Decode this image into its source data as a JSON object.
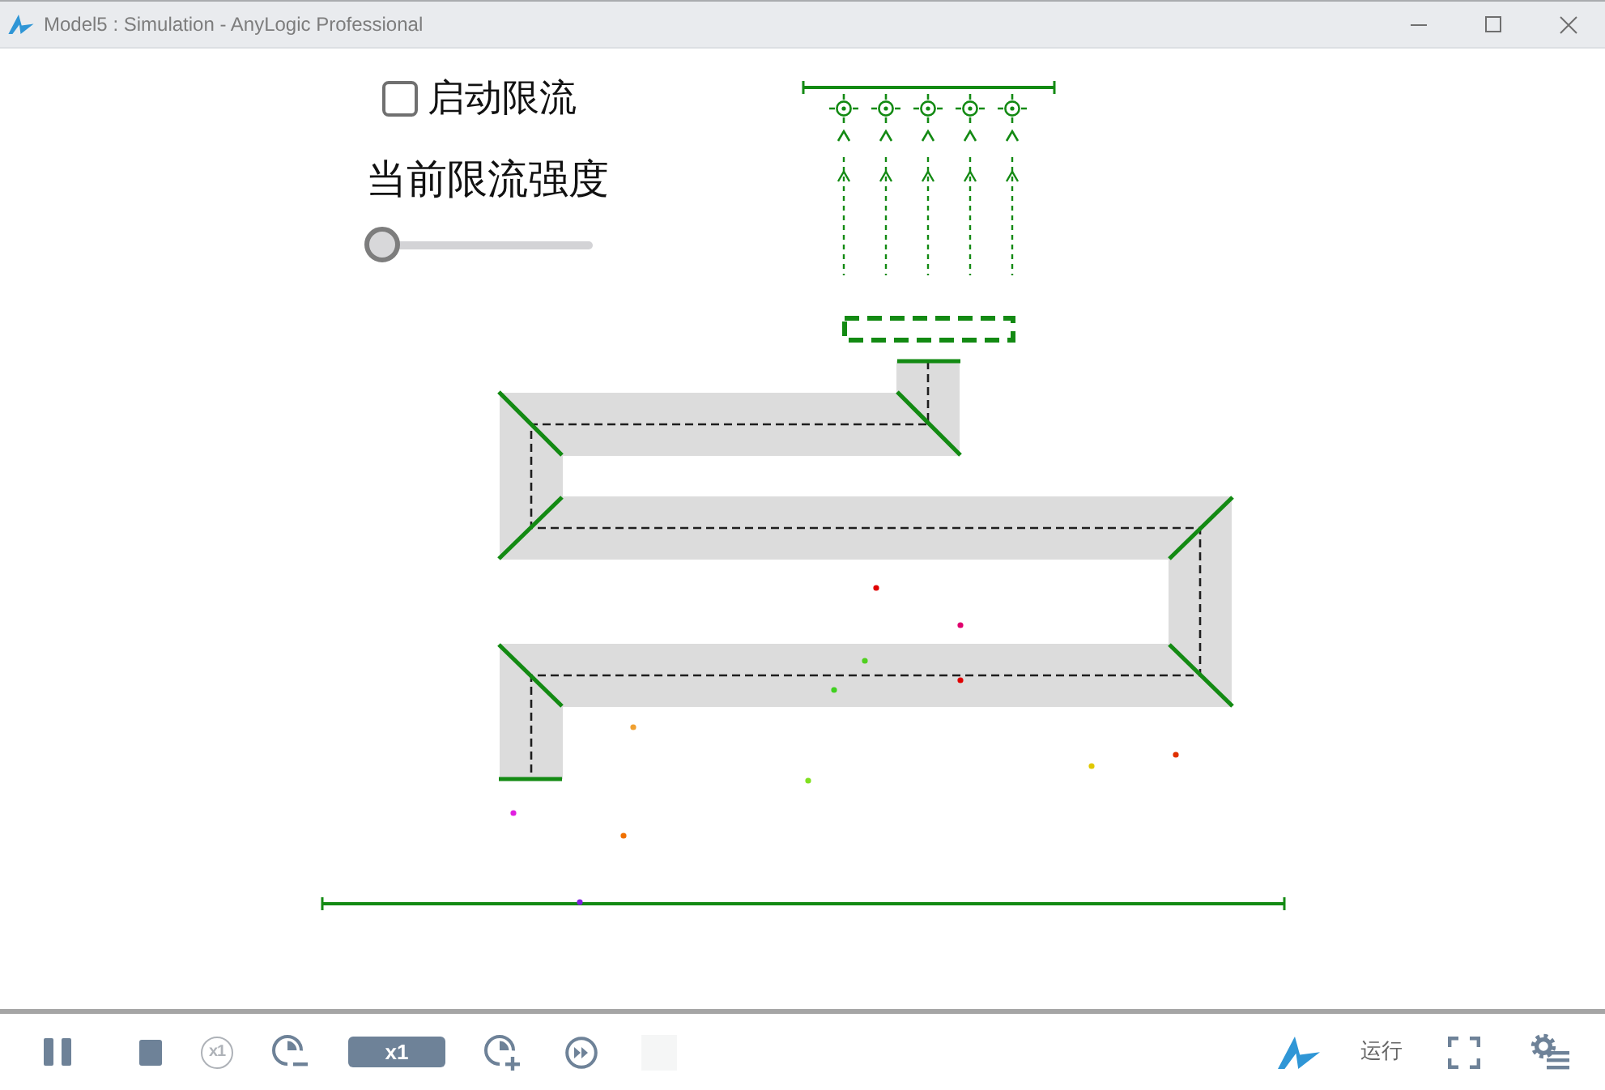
{
  "window": {
    "title": "Model5 : Simulation - AnyLogic Professional",
    "controls": [
      {
        "kind": "minimize"
      },
      {
        "kind": "maximize"
      },
      {
        "kind": "close"
      }
    ]
  },
  "canvas": {
    "checkbox": {
      "label": "启动限流",
      "checked": false
    },
    "slider": {
      "label": "当前限流强度",
      "level": 0
    },
    "agents": [
      {
        "color": "#e00000"
      },
      {
        "color": "#e0006e"
      },
      {
        "color": "#50d020"
      },
      {
        "color": "#e00000"
      },
      {
        "color": "#40d020"
      },
      {
        "color": "#f0a030"
      },
      {
        "color": "#e03000"
      },
      {
        "color": "#e0c800"
      },
      {
        "color": "#80e020"
      },
      {
        "color": "#e020e0"
      },
      {
        "color": "#f07000"
      },
      {
        "color": "#8020e0"
      }
    ]
  },
  "toolbar": {
    "left": [
      {
        "kind": "pause",
        "disabled": false
      },
      {
        "kind": "stop",
        "disabled": false
      },
      {
        "kind": "reset_speed",
        "label": "x1",
        "disabled": true
      },
      {
        "kind": "slow_down",
        "disabled": false
      },
      {
        "kind": "speed",
        "label": "x1",
        "disabled": false
      },
      {
        "kind": "speed_up",
        "disabled": false
      },
      {
        "kind": "run_max",
        "disabled": false
      },
      {
        "kind": "blank",
        "disabled": true
      }
    ],
    "right": [
      {
        "kind": "logo"
      },
      {
        "kind": "status",
        "label": "运行"
      },
      {
        "kind": "fullscreen"
      },
      {
        "kind": "settings"
      }
    ]
  }
}
